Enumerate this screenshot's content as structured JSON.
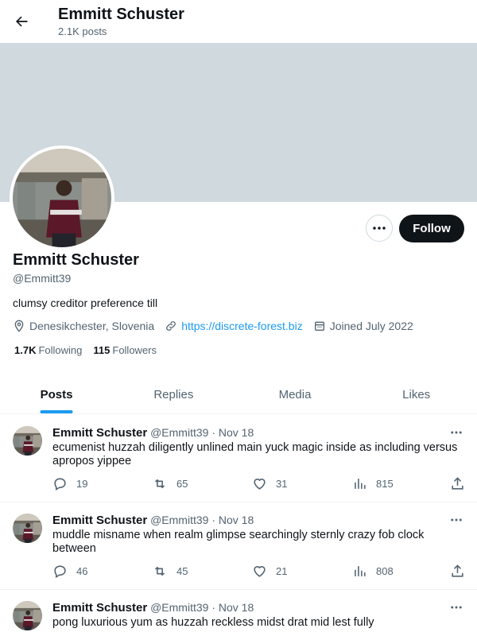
{
  "header": {
    "name": "Emmitt Schuster",
    "posts_count": "2.1K posts"
  },
  "profile": {
    "name": "Emmitt Schuster",
    "handle": "@Emmitt39",
    "bio": "clumsy creditor preference till",
    "location": "Denesikchester, Slovenia",
    "website": "https://discrete-forest.biz",
    "joined": "Joined July 2022",
    "following_count": "1.7K",
    "following_label": "Following",
    "followers_count": "115",
    "followers_label": "Followers",
    "follow_label": "Follow",
    "more_icon": "more-dots-icon"
  },
  "tabs": [
    {
      "label": "Posts",
      "active": true
    },
    {
      "label": "Replies",
      "active": false
    },
    {
      "label": "Media",
      "active": false
    },
    {
      "label": "Likes",
      "active": false
    }
  ],
  "posts": [
    {
      "name": "Emmitt Schuster",
      "handle": "@Emmitt39",
      "date": "· Nov 18",
      "text": "ecumenist huzzah diligently unlined main yuck magic inside as including versus apropos yippee",
      "replies": "19",
      "reposts": "65",
      "likes": "31",
      "views": "815"
    },
    {
      "name": "Emmitt Schuster",
      "handle": "@Emmitt39",
      "date": "· Nov 18",
      "text": "muddle misname when realm glimpse searchingly sternly crazy fob clock between",
      "replies": "46",
      "reposts": "45",
      "likes": "21",
      "views": "808"
    },
    {
      "name": "Emmitt Schuster",
      "handle": "@Emmitt39",
      "date": "· Nov 18",
      "text": "pong luxurious yum as huzzah reckless midst drat mid lest fully",
      "replies": "",
      "reposts": "",
      "likes": "",
      "views": ""
    }
  ],
  "colors": {
    "accent": "#1d9bf0",
    "banner": "#cfd9de",
    "text": "#0f1419",
    "muted": "#536471"
  }
}
